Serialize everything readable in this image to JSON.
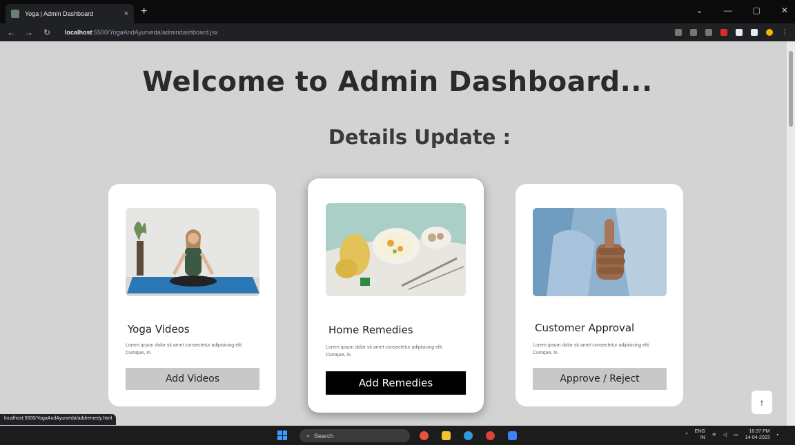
{
  "browser": {
    "tab_title": "Yoga | Admin Dashboard",
    "tab_close": "×",
    "new_tab": "+",
    "url_host": "localhost",
    "url_path": ":5500/YogaAndAyurveda/admindashboard.jsx",
    "window_controls": [
      "⌄",
      "—",
      "▢",
      "✕"
    ],
    "status_url": "localhost:5500/YogaAndAyurveda/addremedy.html"
  },
  "page": {
    "title": "Welcome to Admin Dashboard...",
    "subtitle": "Details Update :",
    "cards": [
      {
        "title": "Yoga Videos",
        "description": "Lorem ipsum dolor sit amet consectetur adipisicing elit. Cumque, in.",
        "button": "Add Videos",
        "image": "yoga-meditation"
      },
      {
        "title": "Home Remedies",
        "description": "Lorem ipsum dolor sit amet consectetur adipisicing elit. Cumque, in.",
        "button": "Add Remedies",
        "image": "home-remedies"
      },
      {
        "title": "Customer Approval",
        "description": "Lorem ipsum dolor sit amet consectetur adipisicing elit. Cumque, in.",
        "button": "Approve / Reject",
        "image": "thumbs-up"
      }
    ],
    "back_to_top": "↑"
  },
  "taskbar": {
    "search_placeholder": "Search",
    "lang": "ENG",
    "lang_sub": "IN",
    "time": "10:37 PM",
    "date": "14-04-2023"
  },
  "colors": {
    "page_bg": "#d3d3d3",
    "card_bg": "#ffffff",
    "primary_button": "#000000",
    "secondary_button": "#c8c8c8"
  }
}
